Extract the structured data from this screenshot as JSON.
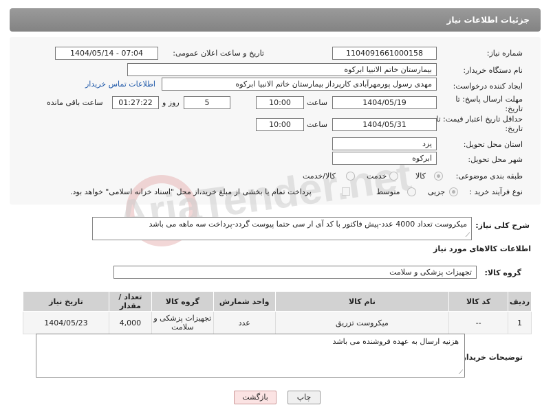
{
  "header": {
    "title": "جزئیات اطلاعات نیاز"
  },
  "fields": {
    "need_number_label": "شماره نیاز:",
    "need_number": "1104091661000158",
    "announce_label": "تاریخ و ساعت اعلان عمومی:",
    "announce_value": "1404/05/14 - 07:04",
    "buyer_org_label": "نام دستگاه خریدار:",
    "buyer_org": "بیمارستان خاتم الانبیا ابرکوه",
    "requester_label": "ایجاد کننده درخواست:",
    "requester": "مهدی رسول پورمهرآبادی کارپرداز بیمارستان خاتم الانبیا ابرکوه",
    "contact_link": "اطلاعات تماس خریدار",
    "reply_deadline_label": "مهلت ارسال پاسخ: تا تاریخ:",
    "reply_date": "1404/05/19",
    "time_label": "ساعت",
    "reply_time": "10:00",
    "days_value": "5",
    "days_label": "روز و",
    "remaining_time": "01:27:22",
    "remaining_label": "ساعت باقی مانده",
    "price_deadline_label": "حداقل تاریخ اعتبار قیمت: تا تاریخ:",
    "price_date": "1404/05/31",
    "price_time": "10:00",
    "province_label": "استان محل تحویل:",
    "province": "یزد",
    "city_label": "شهر محل تحویل:",
    "city": "ابرکوه",
    "category_label": "طبقه بندی موضوعی:",
    "category_options": [
      "کالا",
      "خدمت",
      "کالا/خدمت"
    ],
    "purchase_type_label": "نوع فرآیند خرید :",
    "purchase_options": [
      "جزیی",
      "متوسط"
    ],
    "payment_note": "پرداخت تمام یا بخشی از مبلغ خرید،از محل \"اسناد خزانه اسلامی\" خواهد بود."
  },
  "description": {
    "label": "شرح کلی نیاز:",
    "text": "میکروست تعداد 4000 عدد-پیش فاکتور با کد آی ار سی حتما پیوست گردد-پرداخت سه ماهه می باشد"
  },
  "goods_info": {
    "title": "اطلاعات کالاهای مورد نیاز",
    "group_label": "گروه کالا:",
    "group_value": "تجهیزات پزشکی و سلامت"
  },
  "table": {
    "headers": [
      "ردیف",
      "کد کالا",
      "نام کالا",
      "واحد شمارش",
      "گروه کالا",
      "تعداد / مقدار",
      "تاریخ نیاز"
    ],
    "rows": [
      [
        "1",
        "--",
        "میکروست تزریق",
        "عدد",
        "تجهیزات پزشکی و سلامت",
        "4,000",
        "1404/05/23"
      ]
    ]
  },
  "buyer_notes": {
    "label": "توضیحات خریدار:",
    "text": "هزنیه ارسال به عهده فروشنده می باشد"
  },
  "buttons": {
    "print": "چاپ",
    "back": "بازگشت"
  },
  "watermark": "AriaTender.net"
}
